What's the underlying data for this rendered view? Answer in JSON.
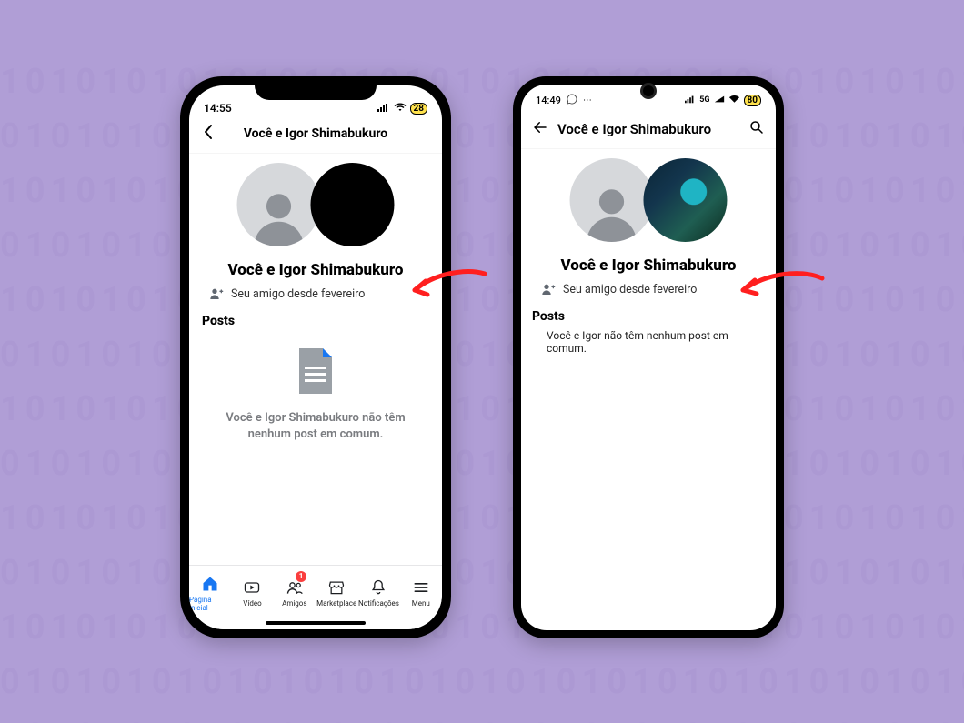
{
  "ios": {
    "status": {
      "time": "14:55",
      "battery": "28"
    },
    "header_title": "Você e Igor Shimabukuro",
    "profile_title": "Você e Igor Shimabukuro",
    "friend_since": "Seu amigo desde fevereiro",
    "posts_label": "Posts",
    "empty_line1": "Você e Igor Shimabukuro não têm",
    "empty_line2": "nenhum post em comum.",
    "tabs": {
      "home": "Página inicial",
      "video": "Vídeo",
      "friends": "Amigos",
      "friends_badge": "1",
      "marketplace": "Marketplace",
      "notifications": "Notificações",
      "menu": "Menu"
    }
  },
  "android": {
    "status": {
      "time": "14:49",
      "network": "5G",
      "battery": "80"
    },
    "header_title": "Você e Igor Shimabukuro",
    "profile_title": "Você e Igor Shimabukuro",
    "friend_since": "Seu amigo desde fevereiro",
    "posts_label": "Posts",
    "empty_text": "Você e Igor não têm nenhum post em comum."
  }
}
